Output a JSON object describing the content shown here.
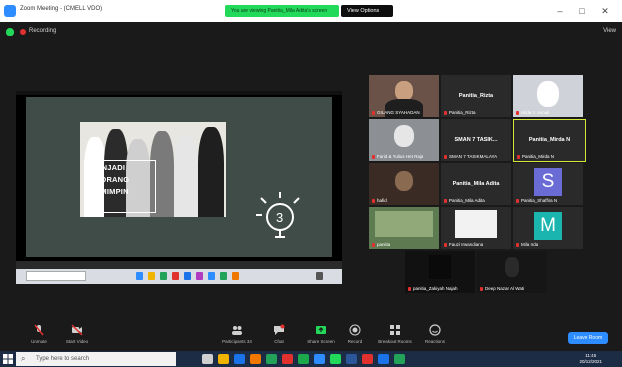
{
  "window": {
    "title": "Zoom Meeting - (CMELL VDO)",
    "share_banner": "You are viewing Panitia_Mila Adita's screen",
    "view_options": "View Options",
    "minimize": "–",
    "maximize": "□",
    "close": "✕"
  },
  "recording": {
    "label": "Recording",
    "view_label": "View"
  },
  "slide": {
    "title_lines": [
      "MENJADI",
      "SEORANG",
      "PEMIMPIN"
    ],
    "bulb_number": "3"
  },
  "share_taskbar": {
    "search": "Type here to search"
  },
  "gallery": [
    {
      "label": "GILANG SYAHADAN",
      "kind": "video",
      "bg": "#6b5248"
    },
    {
      "label": "Panitia_Rizta",
      "kind": "name",
      "name": "Panitia_Rizta"
    },
    {
      "label": "Hilda Y. Ismail",
      "kind": "video",
      "bg": "#cfd2d8"
    },
    {
      "label": "Farid & Yulius Het Raja",
      "kind": "video",
      "bg": "#8c8f94"
    },
    {
      "label": "SMAN 7 TASIKMALAYA",
      "kind": "name",
      "name": "SMAN 7 TASIK..."
    },
    {
      "label": "Panitia_Mirda N",
      "kind": "name",
      "name": "Panitia_Mirda N",
      "highlight": true
    },
    {
      "label": "hafid",
      "kind": "video",
      "bg": "#3a2b24"
    },
    {
      "label": "Panitia_Mila Adita",
      "kind": "name",
      "name": "Panitia_Mila Adita"
    },
    {
      "label": "Panitia_Shaffira N",
      "kind": "letter",
      "letter": "S",
      "bg": "#6b6bd6"
    },
    {
      "label": "panitia",
      "kind": "video",
      "bg": "#5e7a50"
    },
    {
      "label": "Fauzi Irwandiana",
      "kind": "video",
      "bg": "#f2f2f2"
    },
    {
      "label": "Mila Irda",
      "kind": "letter",
      "letter": "M",
      "bg": "#1bb5b0"
    },
    {
      "label": "panitia_Zakiyah Najah",
      "kind": "video",
      "bg": "#111111"
    },
    {
      "label": "Deep Nazar Al Wati",
      "kind": "video",
      "bg": "#161616"
    }
  ],
  "toolbar": {
    "unmute": "Unmute",
    "start_video": "Start Video",
    "participants": "Participants",
    "participants_count": "34",
    "chat": "Chat",
    "share_screen": "Share Screen",
    "record": "Record",
    "breakout_rooms": "Breakout Rooms",
    "reactions": "Reactions",
    "end": "Leave Room"
  },
  "taskbar": {
    "search": "Type here to search",
    "time": "11:45",
    "date": "20/12/2021"
  },
  "colors": {
    "zoom_blue": "#2d8cff",
    "share_green": "#23d959",
    "highlight": "#d4e638",
    "record_red": "#e0312f"
  }
}
